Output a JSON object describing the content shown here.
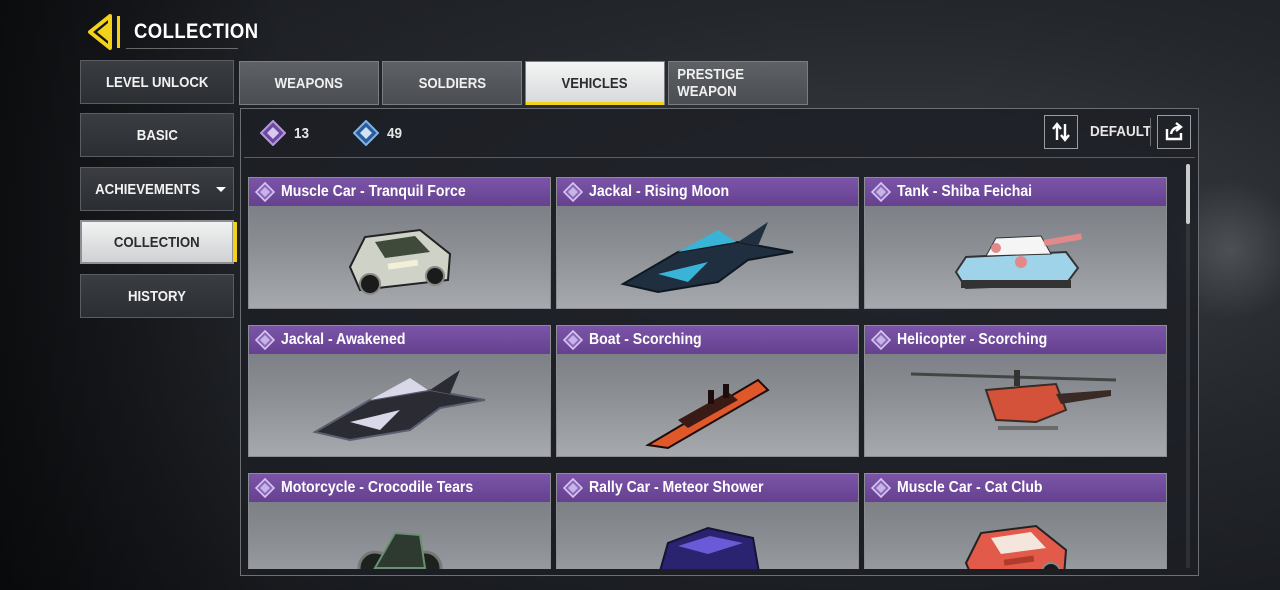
{
  "header": {
    "title": "COLLECTION"
  },
  "sidebar": {
    "items": [
      {
        "label": "LEVEL UNLOCK"
      },
      {
        "label": "BASIC"
      },
      {
        "label": "ACHIEVEMENTS"
      },
      {
        "label": "COLLECTION",
        "active": true
      },
      {
        "label": "HISTORY"
      }
    ]
  },
  "tabs": [
    {
      "label": "WEAPONS"
    },
    {
      "label": "SOLDIERS"
    },
    {
      "label": "VEHICLES",
      "active": true
    },
    {
      "label": "PRESTIGE WEAPON"
    }
  ],
  "stats": {
    "owned_count": "13",
    "total_count": "49"
  },
  "sort": {
    "label": "DEFAULT"
  },
  "colors": {
    "accent_yellow": "#f4d21a",
    "rarity_purple": "#7b54a8"
  },
  "cards": [
    {
      "name": "Muscle Car - Tranquil Force",
      "icon": "muscle-car",
      "palette": [
        "#cfd2c7",
        "#3f4a3a",
        "#f2f0d8"
      ]
    },
    {
      "name": "Jackal - Rising Moon",
      "icon": "jet",
      "palette": [
        "#1f2f3f",
        "#39b3d6",
        "#0f1820"
      ]
    },
    {
      "name": "Tank - Shiba Feichai",
      "icon": "tank",
      "palette": [
        "#9fd3ea",
        "#e28a8a",
        "#f5f5f5"
      ]
    },
    {
      "name": "Jackal - Awakened",
      "icon": "jet",
      "palette": [
        "#2a2b33",
        "#d8d8e8",
        "#5b5c70"
      ]
    },
    {
      "name": "Boat - Scorching",
      "icon": "boat",
      "palette": [
        "#3a1a14",
        "#e0572a",
        "#1a0d0b"
      ]
    },
    {
      "name": "Helicopter - Scorching",
      "icon": "helicopter",
      "palette": [
        "#3a2a26",
        "#d4523a",
        "#6a6a6a"
      ]
    },
    {
      "name": "Motorcycle - Crocodile Tears",
      "icon": "motorcycle",
      "palette": [
        "#2e3a30",
        "#6b8f72",
        "#1c221d"
      ]
    },
    {
      "name": "Rally Car - Meteor Shower",
      "icon": "rally-car",
      "palette": [
        "#2a2470",
        "#6b5ad8",
        "#151233"
      ]
    },
    {
      "name": "Muscle Car - Cat Club",
      "icon": "muscle-car",
      "palette": [
        "#e25a4a",
        "#f4e6dc",
        "#b23a2c"
      ]
    }
  ]
}
